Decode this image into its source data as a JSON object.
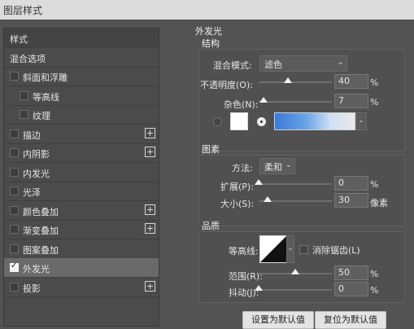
{
  "window_title": "图层样式",
  "left": {
    "header": "样式",
    "items": [
      {
        "label": "混合选项",
        "checkbox": false,
        "plus": false,
        "checked": false,
        "indent": 0
      },
      {
        "label": "斜面和浮雕",
        "checkbox": true,
        "plus": false,
        "checked": false,
        "indent": 0
      },
      {
        "label": "等高线",
        "checkbox": true,
        "plus": false,
        "checked": false,
        "indent": 1
      },
      {
        "label": "纹理",
        "checkbox": true,
        "plus": false,
        "checked": false,
        "indent": 1
      },
      {
        "label": "描边",
        "checkbox": true,
        "plus": true,
        "checked": false,
        "indent": 0
      },
      {
        "label": "内阴影",
        "checkbox": true,
        "plus": true,
        "checked": false,
        "indent": 0
      },
      {
        "label": "内发光",
        "checkbox": true,
        "plus": false,
        "checked": false,
        "indent": 0
      },
      {
        "label": "光泽",
        "checkbox": true,
        "plus": false,
        "checked": false,
        "indent": 0
      },
      {
        "label": "颜色叠加",
        "checkbox": true,
        "plus": true,
        "checked": false,
        "indent": 0
      },
      {
        "label": "渐变叠加",
        "checkbox": true,
        "plus": true,
        "checked": false,
        "indent": 0
      },
      {
        "label": "图案叠加",
        "checkbox": true,
        "plus": false,
        "checked": false,
        "indent": 0
      },
      {
        "label": "外发光",
        "checkbox": true,
        "plus": false,
        "checked": true,
        "indent": 0
      },
      {
        "label": "投影",
        "checkbox": true,
        "plus": true,
        "checked": false,
        "indent": 0
      }
    ]
  },
  "right": {
    "title": "外发光",
    "structure": {
      "title": "结构",
      "blend_mode_label": "混合模式:",
      "blend_mode_value": "滤色",
      "opacity_label": "不透明度(O):",
      "opacity_value": "40",
      "opacity_unit": "%",
      "opacity_level": 0.4,
      "noise_label": "杂色(N):",
      "noise_value": "7",
      "noise_unit": "%",
      "noise_level": 0.07,
      "color_hex": "#ffffff",
      "gradient_colors": [
        "#3b79d7",
        "#6aa5e6",
        "#cfe0f5"
      ]
    },
    "elements": {
      "title": "图素",
      "method_label": "方法:",
      "method_value": "柔和",
      "spread_label": "扩展(P):",
      "spread_value": "0",
      "spread_unit": "%",
      "spread_level": 0,
      "size_label": "大小(S):",
      "size_value": "30",
      "size_unit": "像素",
      "size_level": 0.12
    },
    "quality": {
      "title": "品质",
      "contour_label": "等高线:",
      "antialias_label": "消除锯齿(L)",
      "range_label": "范围(R):",
      "range_value": "50",
      "range_unit": "%",
      "range_level": 0.5,
      "jitter_label": "抖动(J):",
      "jitter_value": "0",
      "jitter_unit": "%",
      "jitter_level": 0
    },
    "buttons": {
      "set_default": "设置为默认值",
      "reset_default": "复位为默认值"
    }
  }
}
